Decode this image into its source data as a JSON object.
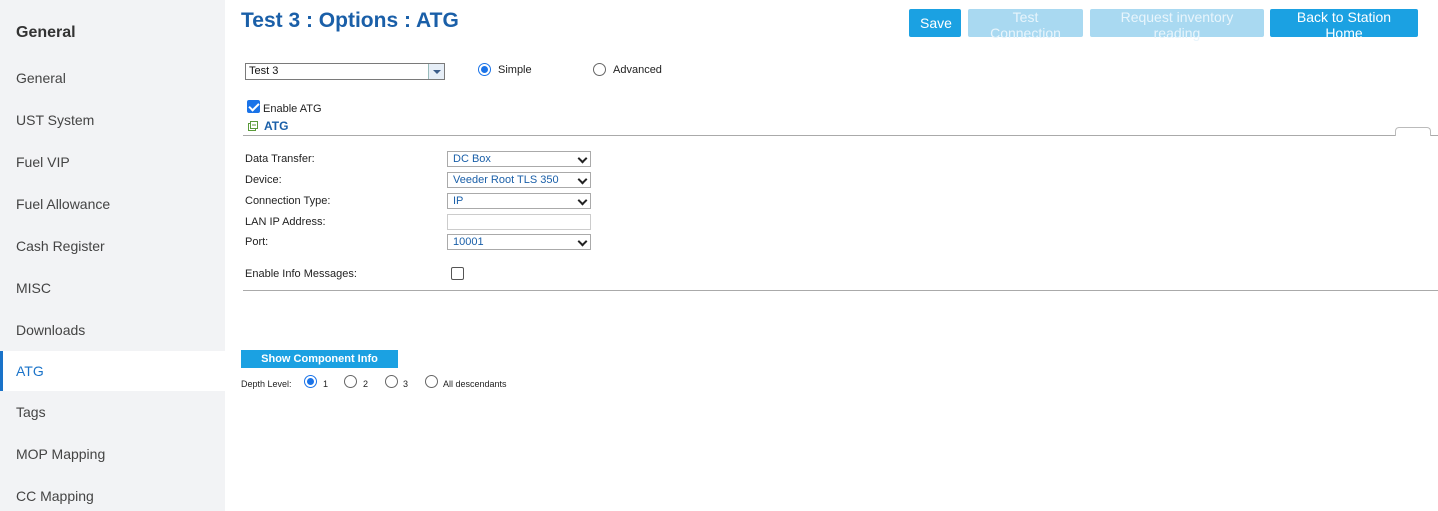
{
  "sidebar": {
    "header": "General",
    "items": [
      {
        "label": "General"
      },
      {
        "label": "UST System"
      },
      {
        "label": "Fuel VIP"
      },
      {
        "label": "Fuel Allowance"
      },
      {
        "label": "Cash Register"
      },
      {
        "label": "MISC"
      },
      {
        "label": "Downloads"
      },
      {
        "label": "ATG",
        "active": true
      },
      {
        "label": "Tags"
      },
      {
        "label": "MOP Mapping"
      },
      {
        "label": "CC Mapping"
      }
    ]
  },
  "header": {
    "title": "Test 3 : Options : ATG",
    "buttons": {
      "save": "Save",
      "test_connection": "Test Connection",
      "request_inventory": "Request inventory reading",
      "back": "Back to Station Home"
    }
  },
  "controls": {
    "station_select": "Test 3",
    "mode": {
      "simple": "Simple",
      "advanced": "Advanced",
      "selected": "Simple"
    },
    "enable_atg_label": "Enable ATG",
    "enable_atg_checked": true
  },
  "section": {
    "title": "ATG"
  },
  "form": {
    "data_transfer": {
      "label": "Data Transfer:",
      "value": "DC Box"
    },
    "device": {
      "label": "Device:",
      "value": "Veeder Root TLS 350"
    },
    "connection_type": {
      "label": "Connection Type:",
      "value": "IP"
    },
    "lan_ip": {
      "label": "LAN IP Address:",
      "value": ""
    },
    "port": {
      "label": "Port:",
      "value": "10001"
    },
    "enable_info": {
      "label": "Enable Info Messages:",
      "checked": false
    }
  },
  "component_info": {
    "button_label": "Show Component Info",
    "depth_label": "Depth Level:",
    "options": [
      "1",
      "2",
      "3",
      "All descendants"
    ],
    "selected": "1"
  },
  "colors": {
    "accent": "#1ba1e2",
    "title_blue": "#1a5fa8",
    "sidebar_bg": "#f2f3f5",
    "disabled_button": "#a9d9f1"
  }
}
